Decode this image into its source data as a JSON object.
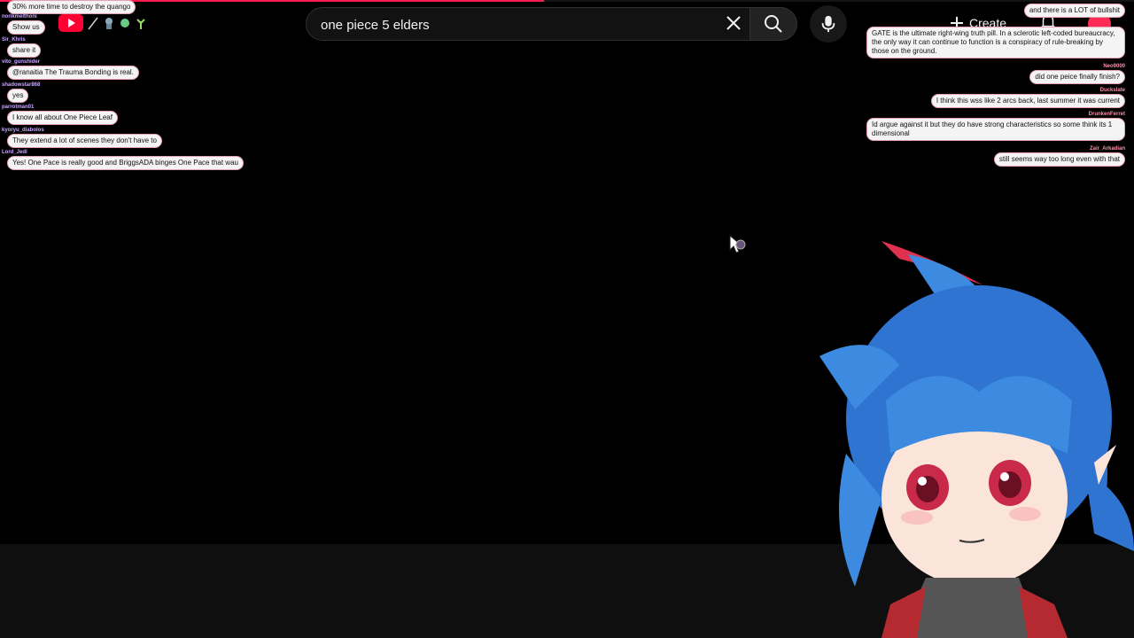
{
  "colors": {
    "accent": "#ff1a4f",
    "youtube_red": "#ff0033",
    "hair_blue": "#3c8be0",
    "eye_red": "#e0324f"
  },
  "progress": 0.48,
  "header": {
    "search_value": "one piece 5 elders",
    "create_label": "Create"
  },
  "icons": {
    "logo": "youtube-logo-icon",
    "clear": "close-icon",
    "search": "search-icon",
    "mic": "microphone-icon",
    "create": "plus-icon",
    "bell": "bell-icon",
    "cursor": "mouse-cursor-icon"
  },
  "chat_left": [
    {
      "user": "",
      "text": "30% more time to destroy the quango"
    },
    {
      "user": "norikmelthoni",
      "text": "Show us"
    },
    {
      "user": "Sir_Khris",
      "text": "share it"
    },
    {
      "user": "vito_gunshider",
      "text": "@ranaitia The Trauma Bonding is real."
    },
    {
      "user": "shadowstar868",
      "text": "yes"
    },
    {
      "user": "parrotman01",
      "text": "I know all about One Piece Leaf"
    },
    {
      "user": "kyoryu_diabolos",
      "text": "They extend a lot of scenes they don't have to"
    },
    {
      "user": "Lord_Jedi",
      "text": "Yes! One Pace is really good and BriggsADA binges One Pace that wau"
    }
  ],
  "chat_right": [
    {
      "user": "",
      "text": "and there is a LOT of bullshit"
    },
    {
      "user": "",
      "text": "GATE is the ultimate right-wing truth pill. In a sclerotic left-coded bureaucracy, the only way it can continue to function is a conspiracy of rule-breaking by those on the ground."
    },
    {
      "user": "Neo9000",
      "text": "did one peice finally finish?"
    },
    {
      "user": "Duckslate",
      "text": "I think this wss like 2 arcs back, last summer it was current"
    },
    {
      "user": "DrunkenFerret",
      "text": "Id argue against it but they do have strong characteristics so some think its 1 dimensional"
    },
    {
      "user": "Zair_Arkadian",
      "text": "still seems way too long even with that"
    }
  ]
}
